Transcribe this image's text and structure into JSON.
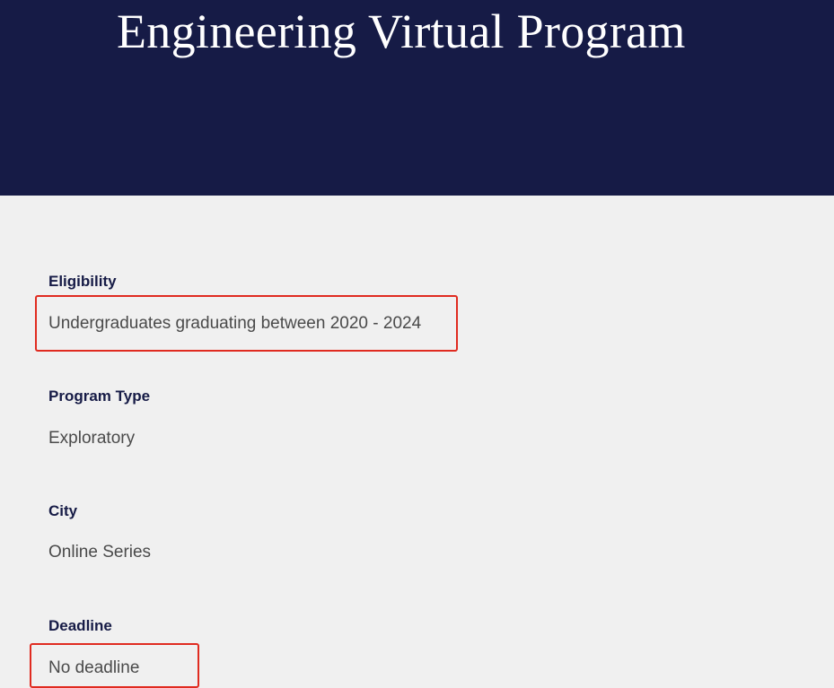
{
  "header": {
    "title": "Engineering Virtual Program",
    "background_color": "#161b46"
  },
  "fields": [
    {
      "label": "Eligibility",
      "value": "Undergraduates graduating between 2020 - 2024",
      "highlighted": true
    },
    {
      "label": "Program Type",
      "value": "Exploratory",
      "highlighted": false
    },
    {
      "label": "City",
      "value": "Online Series",
      "highlighted": false
    },
    {
      "label": "Deadline",
      "value": "No deadline",
      "highlighted": true
    }
  ],
  "colors": {
    "label": "#161b46",
    "value": "#4a4a4a",
    "page_background": "#f0f0f0",
    "highlight_outline": "#e02b20"
  }
}
